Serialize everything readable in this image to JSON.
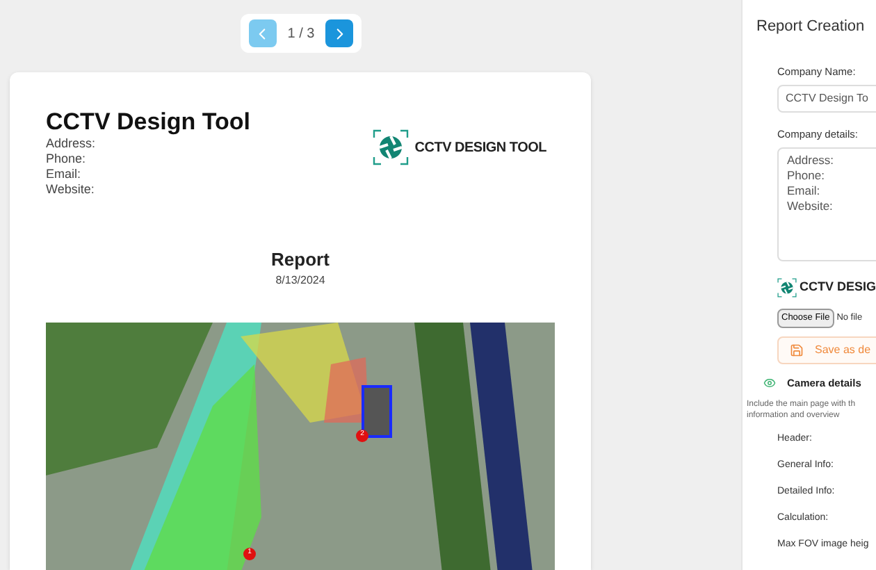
{
  "pagination": {
    "page": "1 / 3",
    "prev_disabled": true
  },
  "report": {
    "company_name": "CCTV Design Tool",
    "details": [
      "Address:",
      "Phone:",
      "Email:",
      "Website:"
    ],
    "logo_text": "CCTV DESIGN TOOL",
    "title": "Report",
    "date": "8/13/2024",
    "cameras": [
      {
        "label": "1"
      },
      {
        "label": "2"
      }
    ]
  },
  "panel": {
    "title": "Report Creation",
    "company_name_label": "Company Name:",
    "company_name_value": "CCTV Design To",
    "company_details_label": "Company details:",
    "company_details_value": "Address:\nPhone:\nEmail:\nWebsite:",
    "logo_text": "CCTV DESIG",
    "file_button": "Choose File",
    "file_status": "No file",
    "save_button": "Save as de",
    "camera_details": {
      "label": "Camera details",
      "visible": true
    },
    "hint": "Include the main page with th\ninformation and overview",
    "fields": [
      "Header:",
      "General Info:",
      "Detailed Info:",
      "Calculation:",
      "Max FOV image heig"
    ]
  }
}
